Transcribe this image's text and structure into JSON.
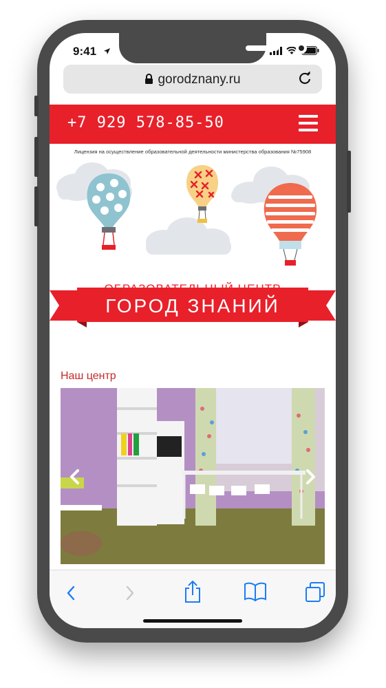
{
  "status": {
    "time": "9:41"
  },
  "browser": {
    "url": "gorodznany.ru"
  },
  "site": {
    "phone": "+7 929 578-85-50",
    "license": "Лицензия на осуществление образовательной деятельности министерства образования №75908",
    "subtitle": "ОБРАЗОВАТЕЛЬНЫЙ ЦЕНТР",
    "title": "ГОРОД ЗНАНИЙ",
    "section_title": "Наш центр"
  },
  "colors": {
    "accent": "#e8202a",
    "toolbar_icon": "#1a7cf5",
    "frame": "#4a4a4a"
  },
  "icons": {
    "status": [
      "location-arrow-icon",
      "signal-icon",
      "wifi-icon",
      "battery-icon"
    ],
    "toolbar": [
      "back-icon",
      "forward-icon",
      "share-icon",
      "bookmarks-icon",
      "tabs-icon"
    ],
    "carousel": [
      "chevron-left-icon",
      "chevron-right-icon"
    ]
  }
}
